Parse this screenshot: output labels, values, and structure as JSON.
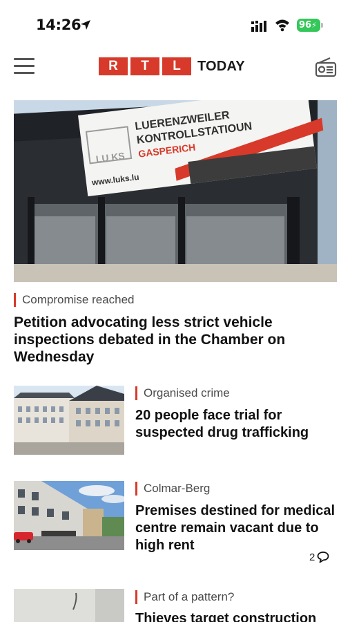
{
  "status_bar": {
    "time": "14:26",
    "battery": "96"
  },
  "header": {
    "logo_letters": [
      "R",
      "T",
      "L"
    ],
    "logo_text": "TODAY",
    "brand_color": "#d73a2a"
  },
  "hero": {
    "sign_line1": "LUERENZWEILER",
    "sign_line2": "KONTROLLSTATIOUN",
    "sign_line3": "GASPERICH",
    "sign_url": "www.luks.lu",
    "sign_logo": "LU KS"
  },
  "articles": [
    {
      "category": "Compromise reached",
      "headline": "Petition advocating less strict vehicle inspections debated in the Chamber on Wednesday"
    },
    {
      "category": "Organised crime",
      "headline": "20 people face trial for suspected drug trafficking"
    },
    {
      "category": "Colmar-Berg",
      "headline": "Premises destined for medical centre remain vacant due to high rent",
      "comment_count": "2"
    },
    {
      "category": "Part of a pattern?",
      "headline": "Thieves target construction"
    }
  ],
  "icons": {
    "menu": "hamburger-menu-icon",
    "radio": "radio-icon",
    "comment": "speech-bubble-icon"
  }
}
